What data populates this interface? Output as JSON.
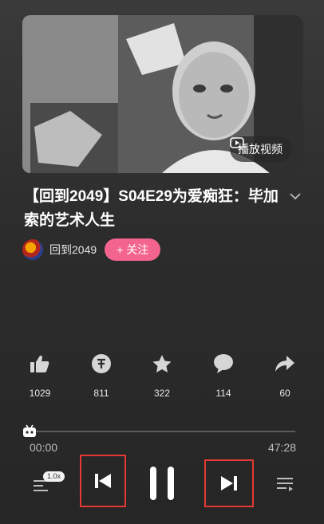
{
  "cover": {
    "play_video_label": "播放视频"
  },
  "episode": {
    "title": "【回到2049】S04E29为爱痴狂：毕加索的艺术人生"
  },
  "channel": {
    "name": "回到2049",
    "follow_label": "关注",
    "follow_plus": "+"
  },
  "actions": [
    {
      "name": "like",
      "icon": "thumbs-up-icon",
      "count": "1029"
    },
    {
      "name": "coin",
      "icon": "coin-icon",
      "count": "811"
    },
    {
      "name": "favorite",
      "icon": "star-icon",
      "count": "322"
    },
    {
      "name": "comment",
      "icon": "comment-icon",
      "count": "114"
    },
    {
      "name": "share",
      "icon": "share-icon",
      "count": "60"
    }
  ],
  "player": {
    "current_time": "00:00",
    "total_time": "47:28",
    "progress": 0,
    "speed": "1.0x",
    "highlight_color": "#e53935"
  },
  "colors": {
    "accent": "#f3658e",
    "background": "#2c2c2c"
  }
}
